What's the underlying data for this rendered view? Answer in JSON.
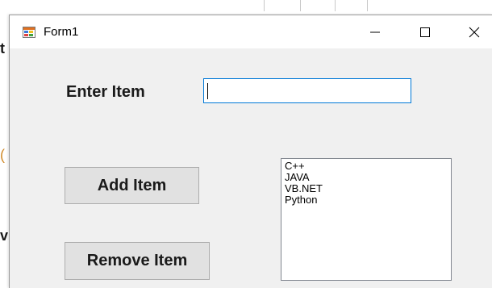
{
  "window": {
    "title": "Form1"
  },
  "controls": {
    "minimize_icon": "minimize-icon",
    "maximize_icon": "maximize-icon",
    "close_icon": "close-icon"
  },
  "form": {
    "enter_label": "Enter Item",
    "item_input_value": "",
    "add_button_label": "Add Item",
    "remove_button_label": "Remove Item",
    "list_items": [
      "C++",
      "JAVA",
      "VB.NET",
      "Python"
    ]
  },
  "colors": {
    "form_background": "#f0f0f0",
    "input_focus_border": "#0078d7",
    "button_face": "#e1e1e1"
  }
}
